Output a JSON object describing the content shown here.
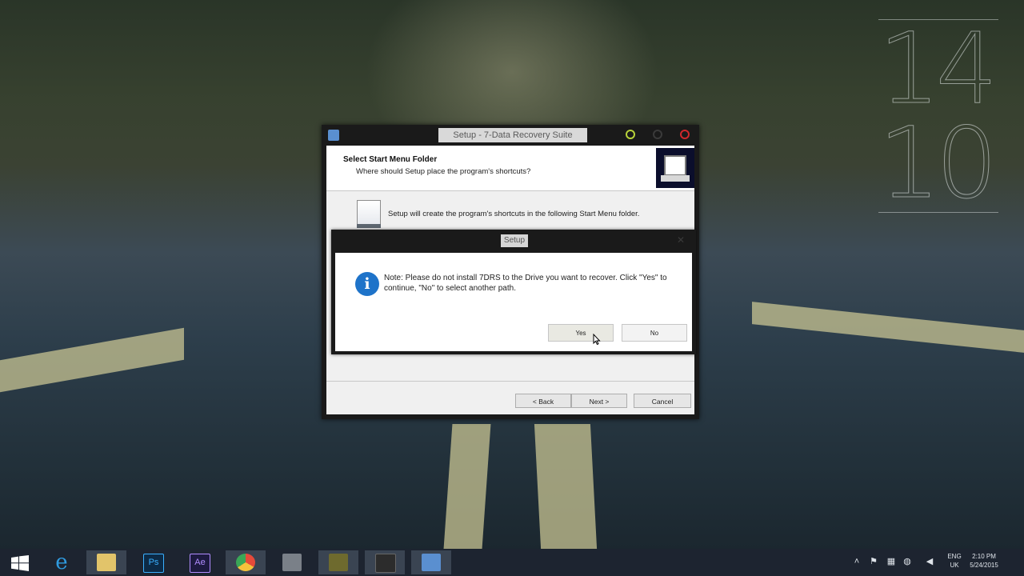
{
  "desktop": {
    "clock_digits": [
      "14",
      "10"
    ]
  },
  "setup_window": {
    "title": "Setup - 7-Data Recovery Suite",
    "header_title": "Select Start Menu Folder",
    "header_subtitle": "Where should Setup place the program's shortcuts?",
    "instruction": "Setup will create the program's shortcuts in the following Start Menu folder.",
    "buttons": {
      "back": "< Back",
      "next": "Next >",
      "cancel": "Cancel"
    },
    "window_button_colors": {
      "minimize": "#b8d23a",
      "maximize": "#3a3a3a",
      "close": "#d0282c"
    }
  },
  "dialog": {
    "title": "Setup",
    "message": "Note: Please do not install 7DRS to the Drive you want to recover. Click \"Yes\" to continue, \"No\" to select another path.",
    "buttons": {
      "yes": "Yes",
      "no": "No"
    },
    "icon": "info-icon"
  },
  "taskbar": {
    "apps": [
      {
        "name": "start-button",
        "icon": "windows-logo-icon",
        "color": "#ffffff"
      },
      {
        "name": "internet-explorer",
        "icon": "ie-icon",
        "color": "#2f9be0"
      },
      {
        "name": "file-explorer",
        "icon": "folder-icon",
        "color": "#e2c46a"
      },
      {
        "name": "photoshop",
        "icon": "photoshop-icon",
        "color": "#0c2a46"
      },
      {
        "name": "after-effects",
        "icon": "after-effects-icon",
        "color": "#1d1a40"
      },
      {
        "name": "chrome",
        "icon": "chrome-icon",
        "color": "#e64a3a"
      },
      {
        "name": "media-app",
        "icon": "media-icon",
        "color": "#7a8088"
      },
      {
        "name": "game-app",
        "icon": "game-icon",
        "color": "#6e6a2e"
      },
      {
        "name": "terminal-app",
        "icon": "app-icon",
        "color": "#2c2c2c"
      },
      {
        "name": "setup-app",
        "icon": "setup-icon",
        "color": "#5a8fd0"
      }
    ],
    "tray": {
      "language": "ENG",
      "region": "UK",
      "time": "2:10 PM",
      "date": "5/24/2015"
    }
  }
}
